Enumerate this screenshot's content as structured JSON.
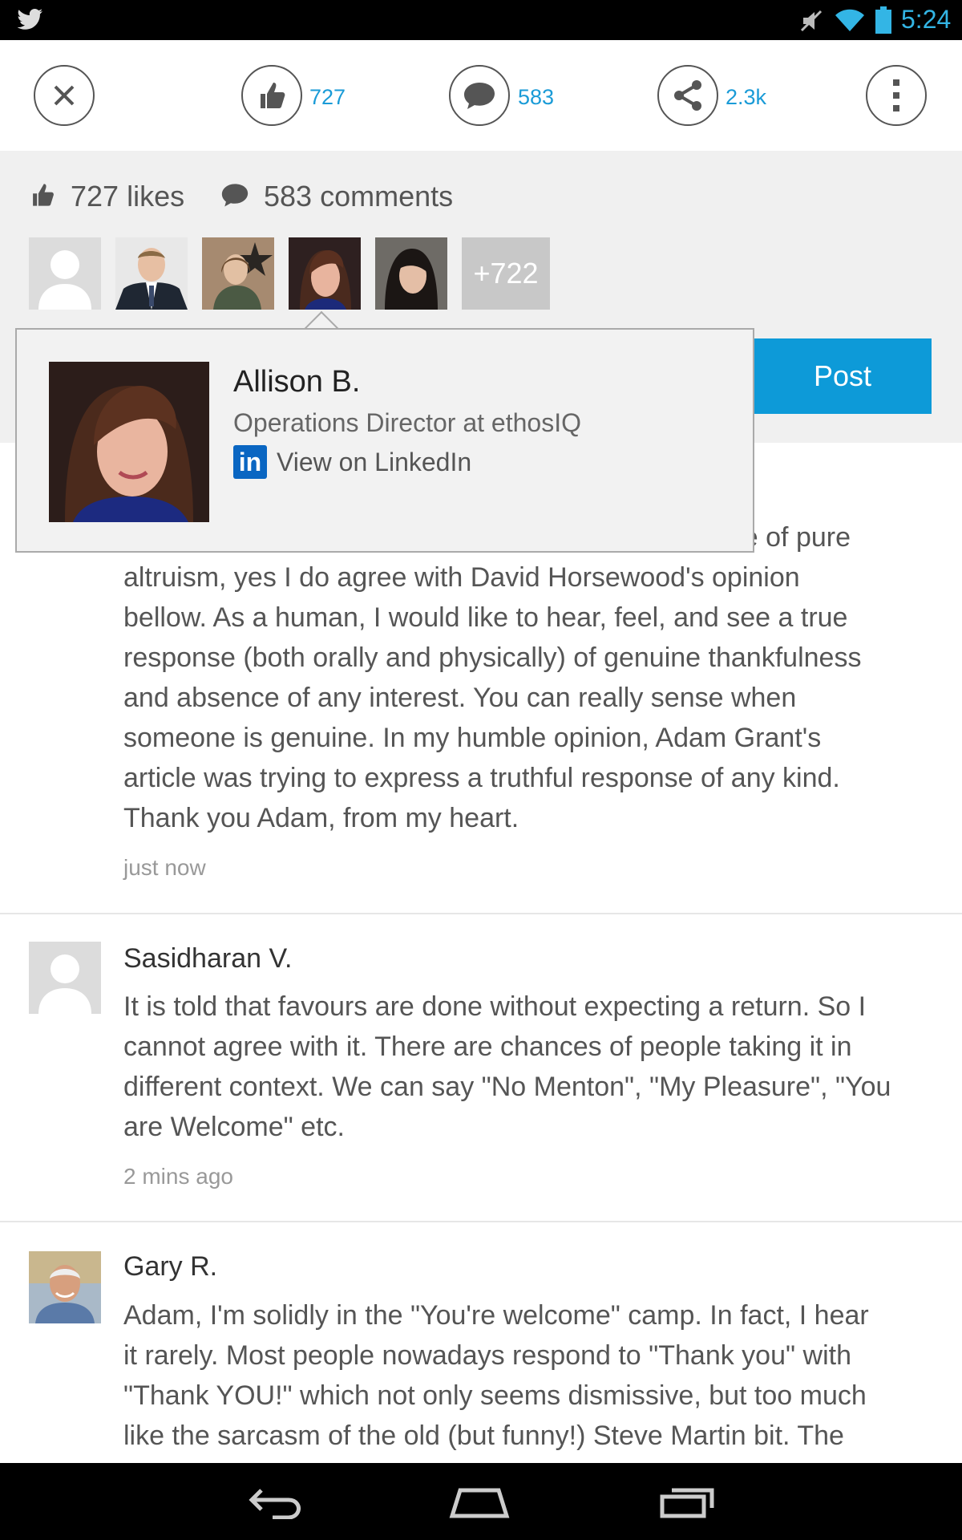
{
  "status_bar": {
    "time": "5:24",
    "icons": [
      "twitter-icon",
      "mute-icon",
      "wifi-icon",
      "battery-icon"
    ]
  },
  "toolbar": {
    "likes_count": "727",
    "comments_count": "583",
    "shares_count": "2.3k"
  },
  "stats": {
    "likes_label": "727 likes",
    "comments_label": "583 comments",
    "more_avatars": "+722"
  },
  "post_button": "Post",
  "popover": {
    "name": "Allison B.",
    "title": "Operations Director at ethosIQ",
    "link_badge": "in",
    "link_text": "View on LinkedIn"
  },
  "comments": [
    {
      "partial_first_line": "mple of pure",
      "lines": [
        "altruism, yes I do agree with David Horsewood's opinion",
        "bellow. As a human, I would like to hear, feel, and see a true",
        "response (both orally and physically) of genuine thankfulness",
        "and absence of any interest. You can really sense when",
        "someone is genuine. In my humble opinion, Adam Grant's",
        "article was trying to express a truthful response of any kind.",
        "Thank you Adam, from my heart."
      ],
      "time": "just now"
    },
    {
      "author": "Sasidharan V.",
      "lines": [
        "It is told that favours are done without expecting a return. So I",
        "cannot agree with it. There are chances of people taking it in",
        "different context. We can say \"No Menton\", \"My Pleasure\", \"You",
        "are Welcome\" etc."
      ],
      "time": "2 mins ago"
    },
    {
      "author": "Gary R.",
      "lines": [
        "Adam, I'm solidly in the \"You're welcome\" camp. In fact, I hear",
        "it rarely. Most people nowadays respond to \"Thank you\" with",
        "\"Thank YOU!\" which not only seems dismissive, but too much",
        "like the sarcasm of the old (but funny!) Steve Martin bit. The"
      ]
    }
  ],
  "colors": {
    "accent": "#1a9bd7",
    "post_button": "#0d9ad8",
    "panel_bg": "#f0f0f0",
    "linkedin": "#0a66c2"
  }
}
